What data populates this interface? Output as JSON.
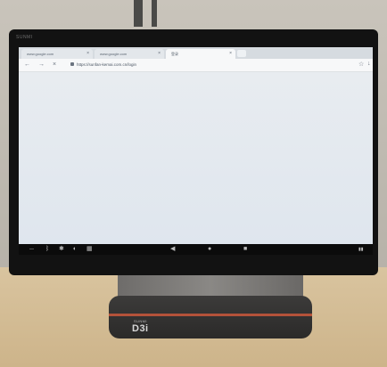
{
  "device": {
    "bezel_brand": "SUNMI",
    "base_brand_small": "SUNMI",
    "base_brand": "D3i"
  },
  "browser": {
    "tabs": [
      {
        "label": "www.google.com",
        "active": false
      },
      {
        "label": "www.google.com",
        "active": false
      },
      {
        "label": "登录",
        "active": true
      }
    ],
    "url": "https://sunfan-kemai.com.cn/login"
  },
  "icons": {
    "back": "arrow-left-icon",
    "forward": "arrow-right-icon",
    "close": "close-icon",
    "star": "star-icon",
    "download": "download-icon",
    "lock": "lock-icon"
  }
}
